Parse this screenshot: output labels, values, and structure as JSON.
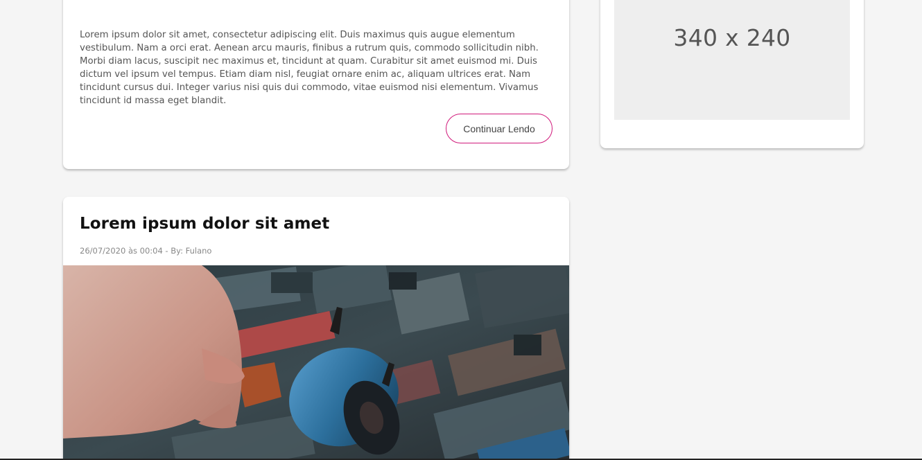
{
  "previous_post": {
    "excerpt": "Lorem ipsum dolor sit amet, consectetur adipiscing elit. Duis maximus quis augue elementum vestibulum. Nam a orci erat. Aenean arcu mauris, finibus a rutrum quis, commodo sollicitudin nibh. Morbi diam lacus, suscipit nec maximus et, tincidunt at quam. Curabitur sit amet euismod mi. Duis dictum vel ipsum vel tempus. Etiam diam nisl, feugiat ornare enim ac, aliquam ultrices erat. Nam tincidunt cursus dui. Integer varius nisi quis dui commodo, vitae euismod nisi elementum. Vivamus tincidunt id massa eget blandit.",
    "read_more_label": "Continuar Lendo"
  },
  "sidebar": {
    "ad_placeholder_label": "340 x 240"
  },
  "post": {
    "title": "Lorem ipsum dolor sit amet",
    "meta": "26/07/2020 às 00:04 - By: Fulano"
  },
  "colors": {
    "accent": "#d0187a",
    "background": "#f5f5f5",
    "card": "#ffffff"
  }
}
